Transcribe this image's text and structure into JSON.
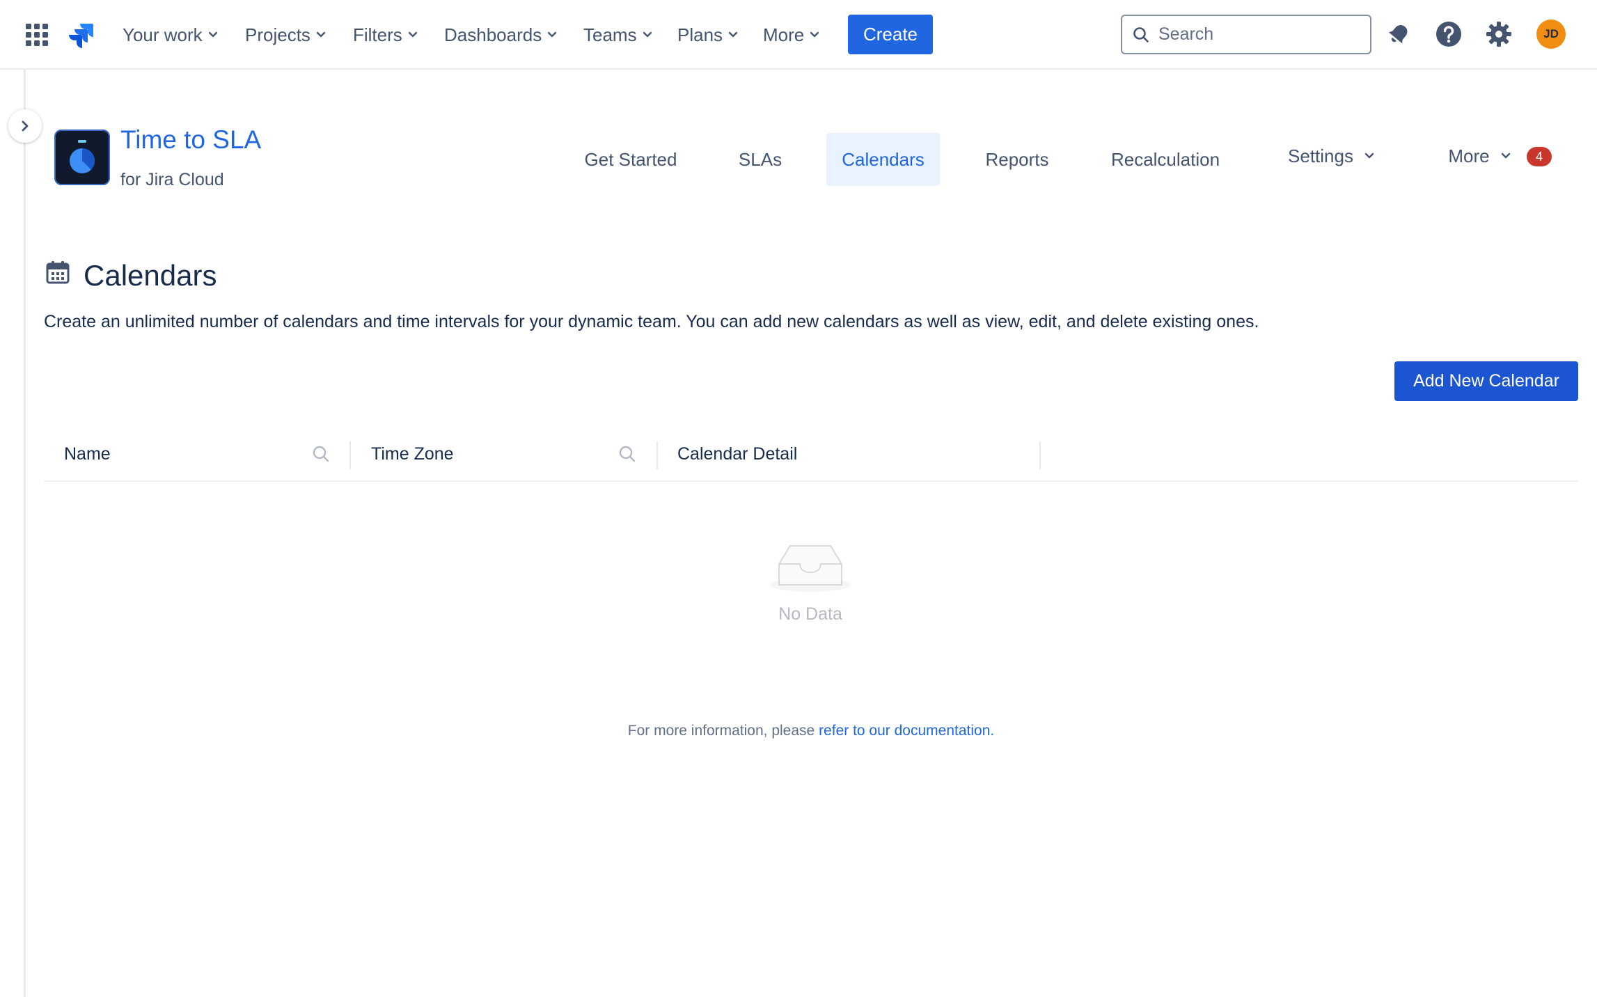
{
  "topnav": {
    "items": [
      {
        "label": "Your work"
      },
      {
        "label": "Projects"
      },
      {
        "label": "Filters"
      },
      {
        "label": "Dashboards"
      },
      {
        "label": "Teams"
      },
      {
        "label": "Plans"
      },
      {
        "label": "More"
      }
    ],
    "create_label": "Create",
    "search_placeholder": "Search",
    "avatar_initials": "JD"
  },
  "app": {
    "title": "Time to SLA",
    "subtitle": "for Jira Cloud",
    "tabs": [
      {
        "label": "Get Started"
      },
      {
        "label": "SLAs"
      },
      {
        "label": "Calendars"
      },
      {
        "label": "Reports"
      },
      {
        "label": "Recalculation"
      },
      {
        "label": "Settings"
      },
      {
        "label": "More"
      }
    ],
    "active_tab": "Calendars",
    "more_badge": "4"
  },
  "page": {
    "title": "Calendars",
    "description": "Create an unlimited number of calendars and time intervals for your dynamic team. You can add new calendars as well as view, edit, and delete existing ones.",
    "add_button": "Add New Calendar"
  },
  "table": {
    "columns": [
      {
        "label": "Name"
      },
      {
        "label": "Time Zone"
      },
      {
        "label": "Calendar Detail"
      }
    ],
    "rows": [],
    "empty_text": "No Data"
  },
  "footer": {
    "prefix": "For more information, please ",
    "link_text": "refer to our documentation."
  },
  "colors": {
    "primary": "#1f66e0",
    "add_button": "#1b55d1",
    "active_tab_bg": "#e9f2ff",
    "badge": "#c9372c",
    "avatar": "#f18d13"
  },
  "icons": [
    "app-switcher-icon",
    "jira-logo-icon",
    "search-icon",
    "notifications-icon",
    "help-icon",
    "settings-icon",
    "chevron-right-icon",
    "stopwatch-icon",
    "calendar-icon",
    "empty-inbox-icon"
  ]
}
